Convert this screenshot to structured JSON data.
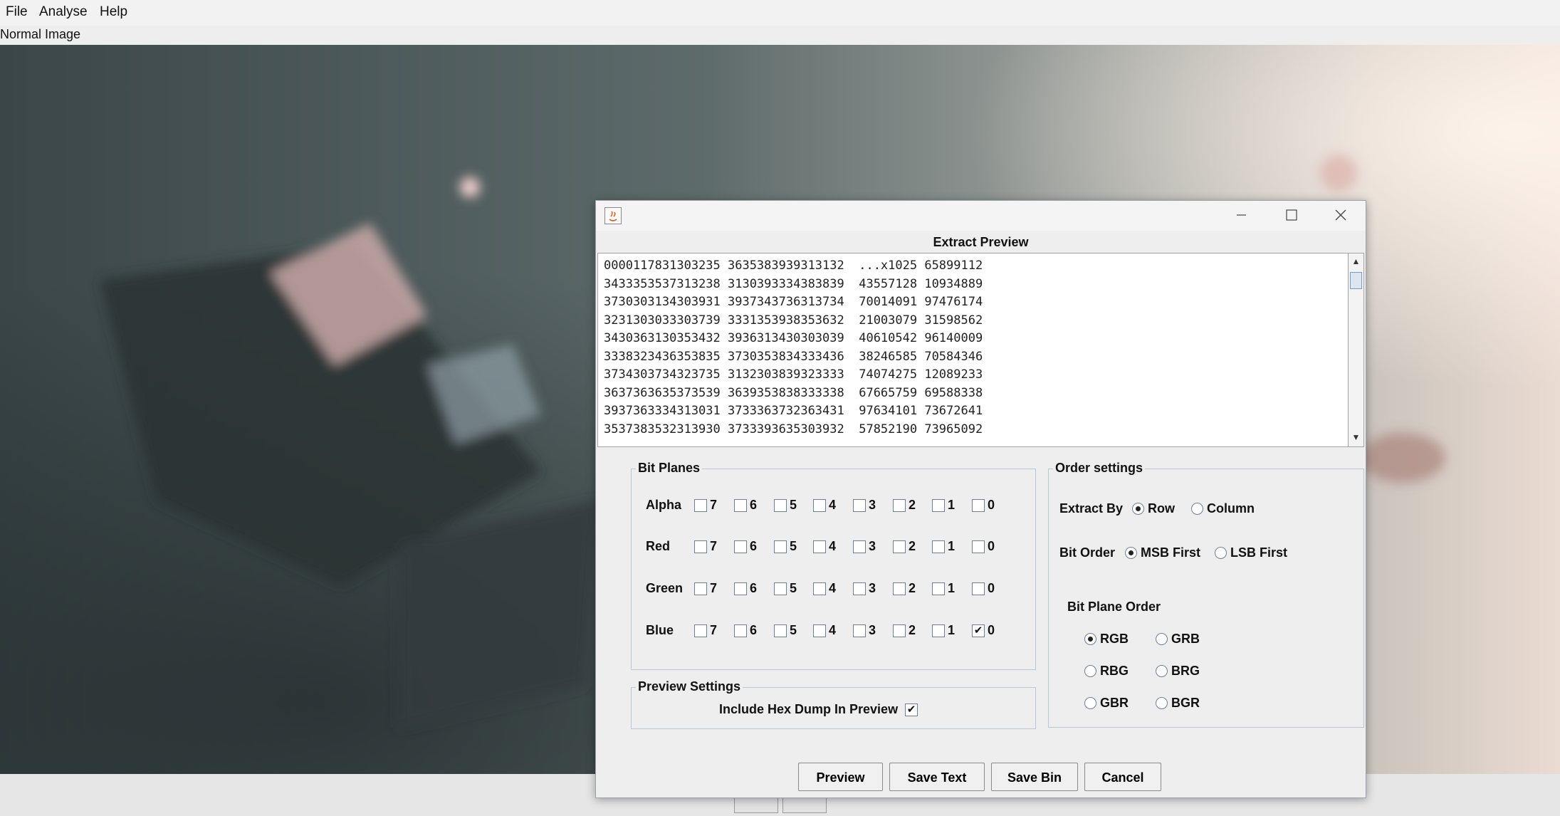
{
  "menu": {
    "items": [
      "File",
      "Analyse",
      "Help"
    ]
  },
  "image_label": "Normal Image",
  "dialog": {
    "title": "Extract Preview",
    "preview_lines": [
      "0000117831303235 3635383939313132  ...x1025 65899112",
      "3433353537313238 3130393334383839  43557128 10934889",
      "3730303134303931 3937343736313734  70014091 97476174",
      "3231303033303739 3331353938353632  21003079 31598562",
      "3430363130353432 3936313430303039  40610542 96140009",
      "3338323436353835 3730353834333436  38246585 70584346",
      "3734303734323735 3132303839323333  74074275 12089233",
      "3637363635373539 3639353838333338  67665759 69588338",
      "3937363334313031 3733363732363431  97634101 73672641",
      "3537383532313930 3733393635303932  57852190 73965092"
    ],
    "bit_planes": {
      "title": "Bit Planes",
      "channels": [
        {
          "name": "Alpha",
          "checked": [
            false,
            false,
            false,
            false,
            false,
            false,
            false,
            false
          ]
        },
        {
          "name": "Red",
          "checked": [
            false,
            false,
            false,
            false,
            false,
            false,
            false,
            false
          ]
        },
        {
          "name": "Green",
          "checked": [
            false,
            false,
            false,
            false,
            false,
            false,
            false,
            false
          ]
        },
        {
          "name": "Blue",
          "checked": [
            false,
            false,
            false,
            false,
            false,
            false,
            false,
            true
          ]
        }
      ],
      "bits": [
        "7",
        "6",
        "5",
        "4",
        "3",
        "2",
        "1",
        "0"
      ]
    },
    "preview_settings": {
      "title": "Preview Settings",
      "hex_dump_label": "Include Hex Dump In Preview",
      "hex_dump_checked": true
    },
    "order_settings": {
      "title": "Order settings",
      "extract_by_label": "Extract By",
      "extract_by_options": [
        "Row",
        "Column"
      ],
      "extract_by_selected": "Row",
      "bit_order_label": "Bit Order",
      "bit_order_options": [
        "MSB First",
        "LSB First"
      ],
      "bit_order_selected": "MSB First",
      "bit_plane_order_title": "Bit Plane Order",
      "bit_plane_order_options": [
        "RGB",
        "GRB",
        "RBG",
        "BRG",
        "GBR",
        "BGR"
      ],
      "bit_plane_order_selected": "RGB"
    },
    "buttons": {
      "preview": "Preview",
      "save_text": "Save Text",
      "save_bin": "Save Bin",
      "cancel": "Cancel"
    }
  },
  "colors": {
    "dialog_bg": "#eeeeee",
    "group_border": "#bac6d2",
    "accent": "#dbe6f2"
  }
}
